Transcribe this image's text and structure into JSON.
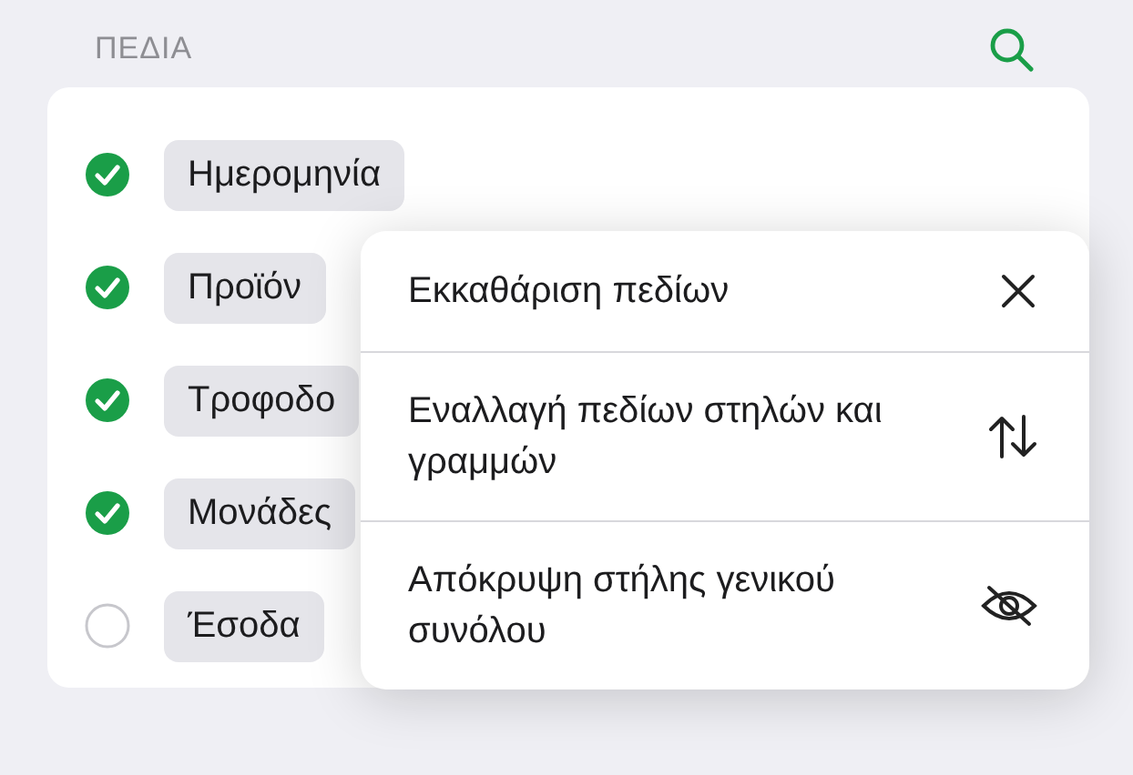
{
  "header": {
    "title": "ΠΕΔΙΑ"
  },
  "fields": [
    {
      "label": "Ημερομηνία",
      "checked": true
    },
    {
      "label": "Προϊόν",
      "checked": true
    },
    {
      "label": "Τροφοδο",
      "checked": true
    },
    {
      "label": "Μονάδες",
      "checked": true
    },
    {
      "label": "Έσοδα",
      "checked": false
    }
  ],
  "menu": [
    {
      "kind": "clear",
      "label": "Εκκαθάριση πεδίων"
    },
    {
      "kind": "swap",
      "label": "Εναλλαγή πεδίων στηλών και γραμμών"
    },
    {
      "kind": "hide",
      "label": "Απόκρυψη στήλης γενικού συνόλου"
    }
  ]
}
